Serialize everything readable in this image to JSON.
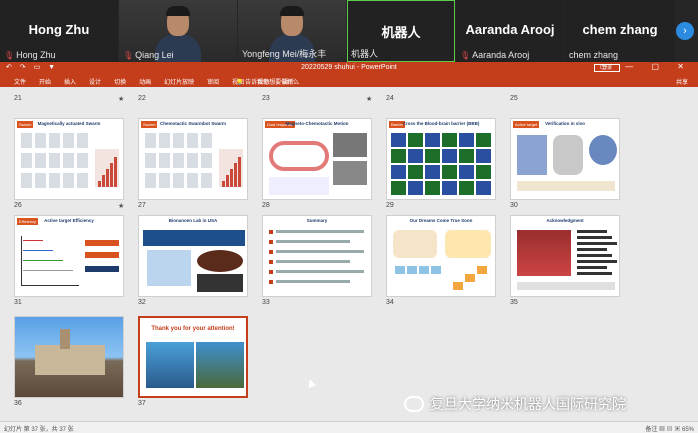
{
  "participants": [
    {
      "name": "Hong Zhu",
      "caption": "Hong Zhu",
      "muted": true,
      "video": false
    },
    {
      "name": "",
      "caption": "Qiang Lei",
      "muted": true,
      "video": true
    },
    {
      "name": "",
      "caption": "Yongfeng Mei/梅永丰",
      "muted": false,
      "video": true
    },
    {
      "name": "机器人",
      "caption": "机器人",
      "muted": false,
      "video": false,
      "active": true
    },
    {
      "name": "Aaranda Arooj",
      "caption": "Aaranda Arooj",
      "muted": true,
      "video": false
    },
    {
      "name": "chem zhang",
      "caption": "chem zhang",
      "muted": false,
      "video": false
    }
  ],
  "next_icon": "chevron-right-icon",
  "ppt": {
    "title": "20220529 shuhui - PowerPoint",
    "quick_access": "↶ ↷ ▭ ▼",
    "sign_in": "登录",
    "window_controls": "▭ — ▢ ✕",
    "tabs": [
      "文件",
      "开始",
      "插入",
      "设计",
      "切换",
      "动画",
      "幻灯片放映",
      "审阅",
      "视图",
      "帮助",
      "福昕"
    ],
    "tell_me": "💡 告诉我你想要做什么",
    "share": "共享",
    "status_left": "幻灯片 第 37 张，共 37 张",
    "status_right": "备注  ▦ ▤ ▣  65%"
  },
  "slides": [
    {
      "num": "21",
      "title": "",
      "tag": "",
      "star": true
    },
    {
      "num": "22",
      "title": "",
      "tag": "",
      "star": false
    },
    {
      "num": "23",
      "title": "",
      "tag": "",
      "star": true
    },
    {
      "num": "24",
      "title": "",
      "tag": "",
      "star": false
    },
    {
      "num": "25",
      "title": "",
      "tag": "",
      "star": false
    },
    {
      "num": "26",
      "title": "Magnetically actuated Swarm",
      "tag": "Swarm",
      "star": true
    },
    {
      "num": "27",
      "title": "Chemotactic Swarmbot Swarm",
      "tag": "Swarm",
      "star": false
    },
    {
      "num": "28",
      "title": "Magneto-Chemotactic Motion",
      "tag": "Dual response",
      "star": false
    },
    {
      "num": "29",
      "title": "Cross the Blood-brain barrier (BBB)",
      "tag": "Barrier",
      "star": false
    },
    {
      "num": "30",
      "title": "Verification in vivo",
      "tag": "Active target",
      "star": false
    },
    {
      "num": "31",
      "title": "Active target Efficiency",
      "tag": "Efficiency",
      "star": false
    },
    {
      "num": "32",
      "title": "Bionanoen Lab in USA",
      "tag": "",
      "star": false
    },
    {
      "num": "33",
      "title": "Summary",
      "tag": "",
      "star": false
    },
    {
      "num": "34",
      "title": "Our Dreams Come True Soon",
      "tag": "",
      "star": false
    },
    {
      "num": "35",
      "title": "Acknowledgment",
      "tag": "",
      "star": false
    },
    {
      "num": "36",
      "title": "",
      "tag": "",
      "star": false
    },
    {
      "num": "37",
      "title": "Thank you for your attention!",
      "tag": "",
      "star": false,
      "selected": true
    }
  ],
  "watermark": "复旦大学纳米机器人国际研究院",
  "colors": {
    "ppt_accent": "#c43e1c",
    "active_speaker": "#5ecb4a",
    "selection": "#c43e1c"
  }
}
